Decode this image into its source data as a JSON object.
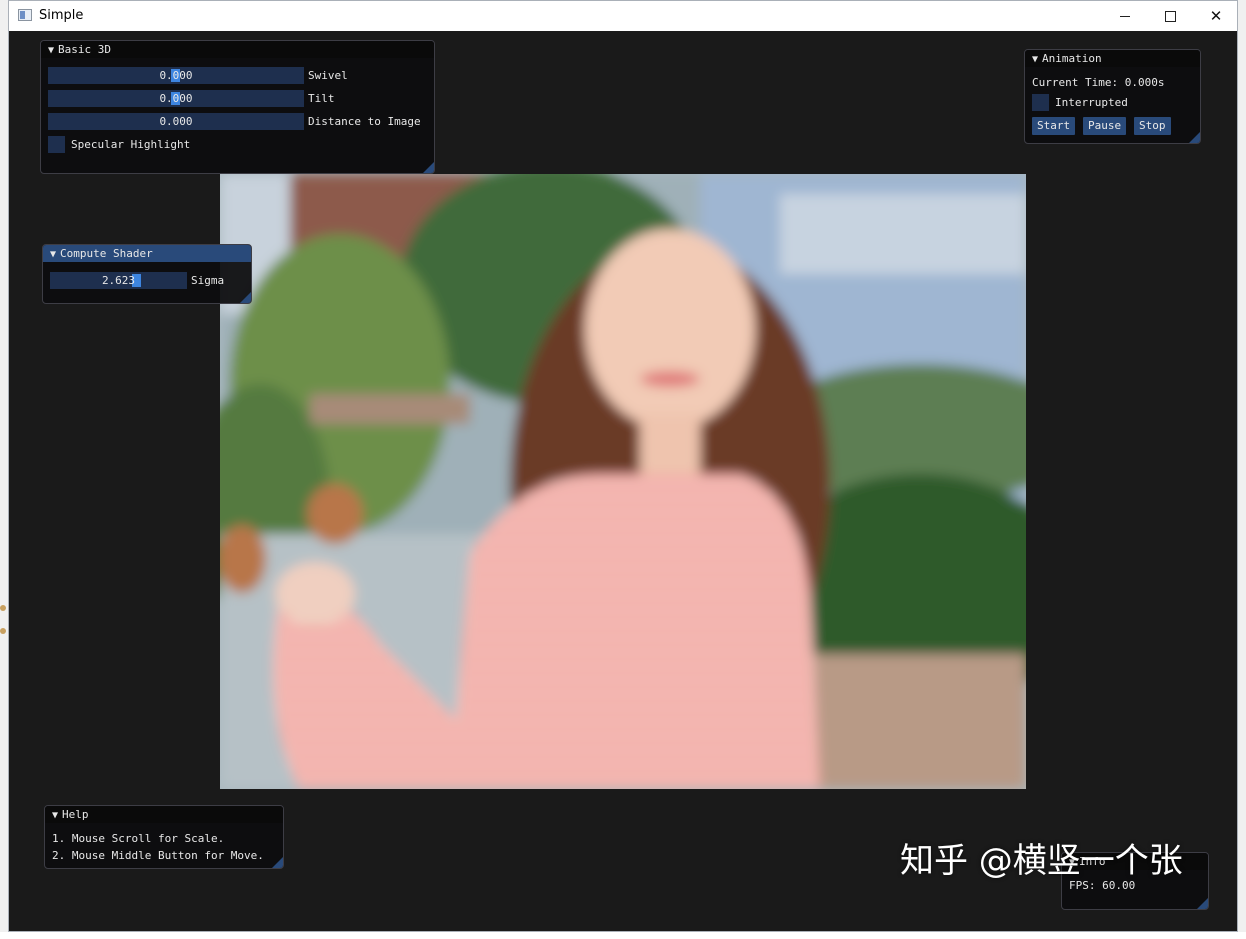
{
  "window": {
    "title": "Simple",
    "icon": "app-window-icon",
    "controls": {
      "minimize": "minimize-icon",
      "maximize": "maximize-icon",
      "close": "✕"
    }
  },
  "basic3d": {
    "title": "Basic 3D",
    "sliders": [
      {
        "value": "0.000",
        "label": "Swivel"
      },
      {
        "value": "0.000",
        "label": "Tilt"
      },
      {
        "value": "0.000",
        "label": "Distance to Image"
      }
    ],
    "checkbox_label": "Specular Highlight"
  },
  "compute": {
    "title": "Compute Shader",
    "slider": {
      "value": "2.623",
      "label": "Sigma"
    }
  },
  "animation": {
    "title": "Animation",
    "current_time": "Current Time: 0.000s",
    "checkbox_label": "Interrupted",
    "buttons": {
      "start": "Start",
      "pause": "Pause",
      "stop": "Stop"
    }
  },
  "help": {
    "title": "Help",
    "lines": [
      "1. Mouse Scroll for Scale.",
      "2. Mouse Middle Button for Move."
    ]
  },
  "info": {
    "title": "Info",
    "fps": "FPS: 60.00"
  },
  "watermark": "知乎 @横竖一个张",
  "colors": {
    "background": "#1a1a1a",
    "frame_bg": "#1e2f4e",
    "accent": "#294a7a",
    "slider_grab": "#3d85e0"
  }
}
